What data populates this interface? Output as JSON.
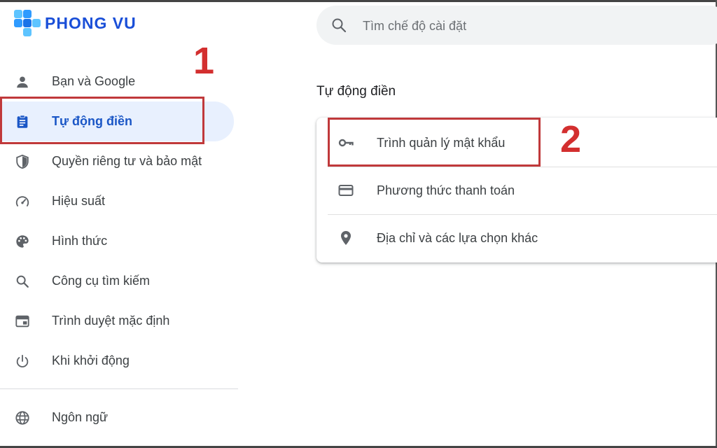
{
  "logo": {
    "text": "PHONG VU"
  },
  "search": {
    "placeholder": "Tìm chế độ cài đặt",
    "icon": "search-icon"
  },
  "sidebar": {
    "items": [
      {
        "label": "Bạn và Google",
        "icon": "person-icon"
      },
      {
        "label": "Tự động điền",
        "icon": "clipboard-icon",
        "active": true
      },
      {
        "label": "Quyền riêng tư và bảo mật",
        "icon": "shield-icon"
      },
      {
        "label": "Hiệu suất",
        "icon": "speedometer-icon"
      },
      {
        "label": "Hình thức",
        "icon": "palette-icon"
      },
      {
        "label": "Công cụ tìm kiếm",
        "icon": "search-icon"
      },
      {
        "label": "Trình duyệt mặc định",
        "icon": "browser-icon"
      },
      {
        "label": "Khi khởi động",
        "icon": "power-icon"
      },
      {
        "label": "Ngôn ngữ",
        "icon": "globe-icon"
      }
    ]
  },
  "main": {
    "section_title": "Tự động điền",
    "rows": [
      {
        "label": "Trình quản lý mật khẩu",
        "icon": "key-icon"
      },
      {
        "label": "Phương thức thanh toán",
        "icon": "credit-card-icon"
      },
      {
        "label": "Địa chỉ và các lựa chọn khác",
        "icon": "location-pin-icon"
      }
    ]
  },
  "callouts": {
    "one": "1",
    "two": "2"
  },
  "colors": {
    "accent": "#1a56c6",
    "active_bg": "#e8f0fe",
    "callout": "#c0393b",
    "logo": "#1a4fd8"
  }
}
